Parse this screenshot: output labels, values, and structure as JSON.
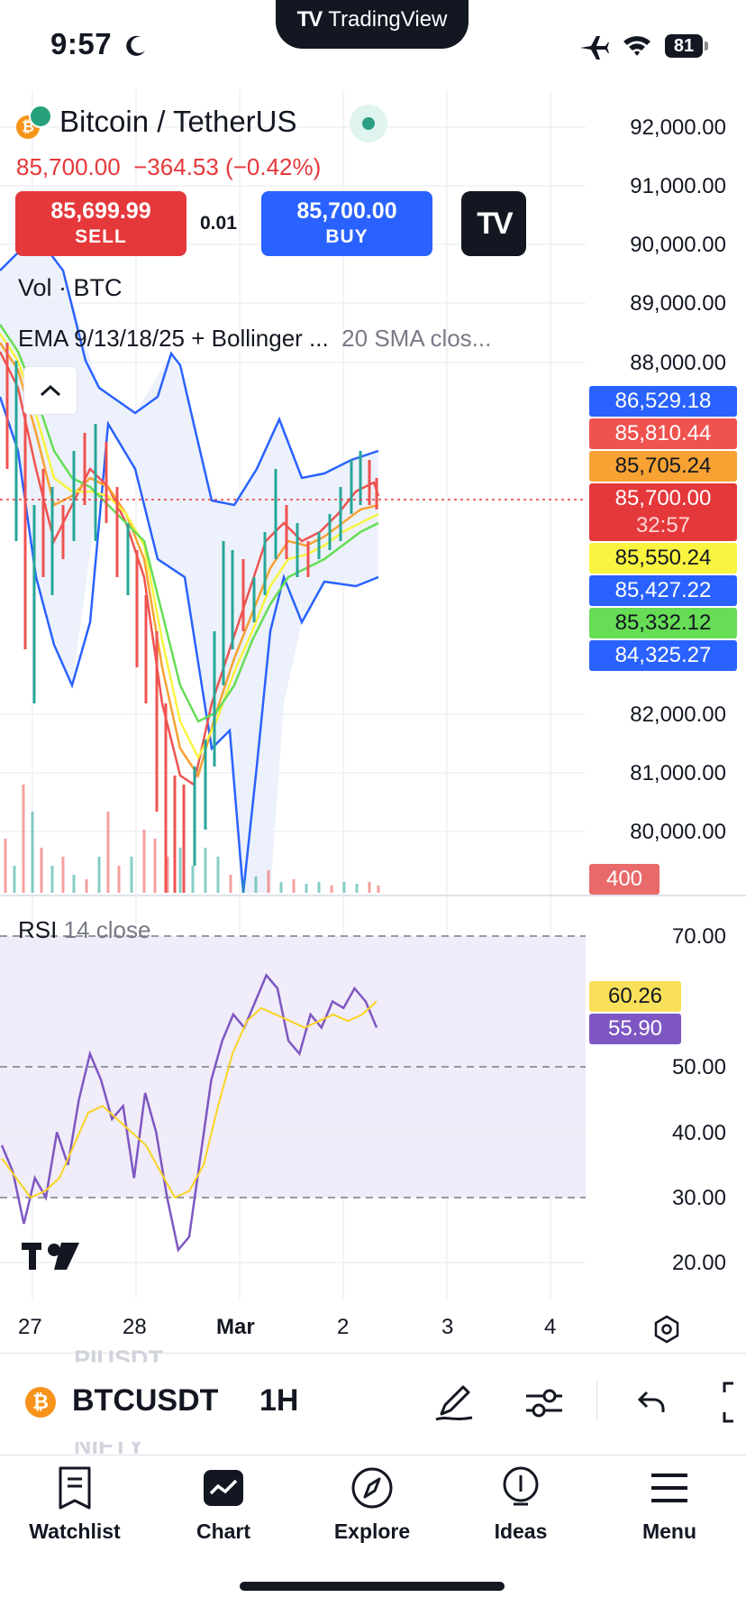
{
  "status_bar": {
    "time": "9:57",
    "battery": "81",
    "center_pill": "TradingView"
  },
  "header": {
    "symbol_title": "Bitcoin / TetherUS",
    "last_price": "85,700.00",
    "change": "−364.53 (−0.42%)",
    "sell_price": "85,699.99",
    "sell_label": "SELL",
    "spread": "0.01",
    "buy_price": "85,700.00",
    "buy_label": "BUY",
    "vol_label": "Vol · BTC",
    "ema_label": "EMA 9/13/18/25 + Bollinger ...",
    "ema_label_muted": "20 SMA clos..."
  },
  "price_axis": {
    "labels": [
      "92,000.00",
      "91,000.00",
      "90,000.00",
      "89,000.00",
      "88,000.00",
      "82,000.00",
      "81,000.00",
      "80,000.00"
    ],
    "tags": [
      {
        "value": "86,529.18",
        "color": "#2962ff"
      },
      {
        "value": "85,810.44",
        "color": "#ef5350"
      },
      {
        "value": "85,705.24",
        "color": "#f7a233"
      },
      {
        "value": "85,700.00",
        "color": "#e5383b",
        "sub": "32:57"
      },
      {
        "value": "85,550.24",
        "color": "#f9f43f",
        "text": "#131722"
      },
      {
        "value": "85,427.22",
        "color": "#2962ff"
      },
      {
        "value": "85,332.12",
        "color": "#66dd55",
        "text": "#131722"
      },
      {
        "value": "84,325.27",
        "color": "#2962ff"
      }
    ],
    "volume_tag": "400"
  },
  "rsi": {
    "label": "RSI",
    "label_muted": "14 close",
    "axis_labels": [
      "70.00",
      "50.00",
      "40.00",
      "30.00",
      "20.00"
    ],
    "tag_ma": "60.26",
    "tag_rsi": "55.90"
  },
  "time_axis": {
    "labels": [
      "27",
      "28",
      "Mar",
      "2",
      "3",
      "4"
    ]
  },
  "toolbar": {
    "symbol": "BTCUSDT",
    "interval": "1H",
    "prev_symbol": "PIUSDT",
    "next_symbol": "NIFTY"
  },
  "nav": [
    {
      "label": "Watchlist",
      "icon": "watchlist-icon"
    },
    {
      "label": "Chart",
      "icon": "chart-icon"
    },
    {
      "label": "Explore",
      "icon": "compass-icon"
    },
    {
      "label": "Ideas",
      "icon": "lightbulb-icon"
    },
    {
      "label": "Menu",
      "icon": "menu-icon"
    }
  ],
  "chart_data": {
    "type": "line",
    "x_labels": [
      "27",
      "28",
      "Mar",
      "2",
      "3",
      "4"
    ],
    "rsi_series": [
      {
        "name": "RSI 14",
        "values": [
          38,
          34,
          26,
          33,
          30,
          40,
          35,
          45,
          52,
          48,
          42,
          44,
          33,
          46,
          40,
          30,
          22,
          24,
          36,
          48,
          54,
          58,
          56,
          60,
          64,
          62,
          54,
          52,
          58,
          56,
          60,
          59,
          62,
          60,
          56
        ]
      },
      {
        "name": "RSI MA",
        "values": [
          36,
          33,
          30,
          31,
          33,
          38,
          43,
          44,
          42,
          40,
          38,
          34,
          30,
          31,
          35,
          44,
          52,
          57,
          59,
          58,
          57,
          56,
          57,
          58,
          57,
          58,
          60
        ]
      }
    ],
    "rsi_levels": [
      70,
      50,
      30
    ]
  }
}
